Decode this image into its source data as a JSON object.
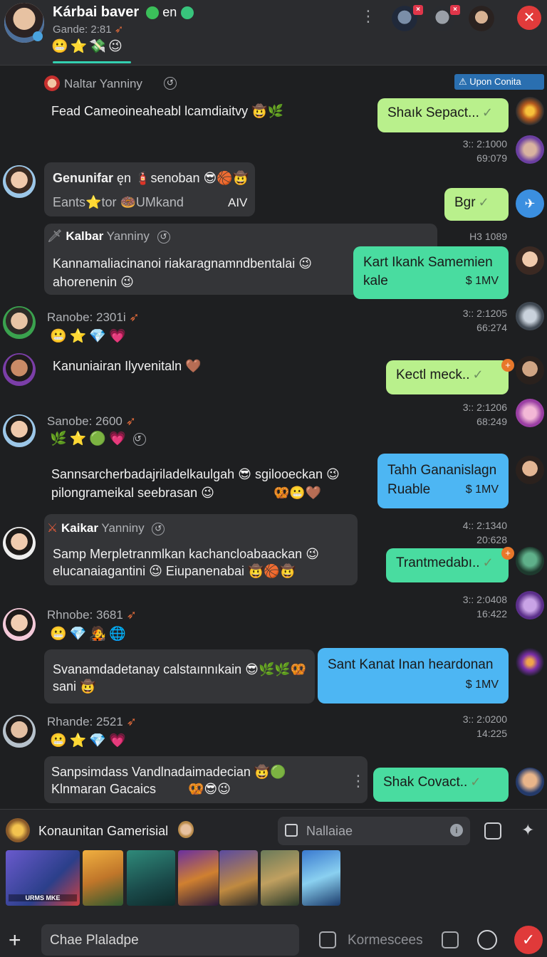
{
  "header": {
    "title": "Kárbai baver",
    "title_suffix": "en",
    "subtitle": "Gande: 2:81",
    "emojis": "😬⭐💸😉"
  },
  "upcoming_button": {
    "label": "Upon Conita"
  },
  "messages": {
    "m1": {
      "sender": "Naltar Yanniny",
      "text": "Fead Cameoineaheabl lcamdiaitvy 🤠🌿"
    },
    "o1": {
      "text": "Shaık Sepact...",
      "time1": "3:: 2:1000",
      "time2": "69:079"
    },
    "m2": {
      "title": "Genunifar",
      "title_rest": "ęn 🧯senoban 😎🏀🤠",
      "line2": "Eants⭐tor 🍩UMkand",
      "tag": "AIV"
    },
    "o2": {
      "text": "Bgr"
    },
    "m3": {
      "sender_bold": "Kalbar",
      "sender_rest": "Yanniny",
      "text1": "Kannamaliacinanoi riakaragnamndbentalai 😉",
      "text2": "ahorenenin 😉",
      "time": "H3 1089"
    },
    "o3": {
      "line1": "Kart Ikank Samemien",
      "line2": "kale",
      "meta": "$ 1MV"
    },
    "m4": {
      "sender": "Ranobe: 2301i",
      "emojis": "😬⭐💎💗"
    },
    "o4_time1": "3:: 2:1205",
    "o4_time2": "66:274",
    "m5": {
      "text": "Kanuniairan Ilyvenitaln 🤎"
    },
    "o5": {
      "text": "Kectl meck.."
    },
    "o5_time1": "3:: 2:1206",
    "o5_time2": "68:249",
    "m6": {
      "sender": "Sanobe: 2600",
      "emojis": "🌿⭐🟢💗",
      "text1": "Sannsarcherbadajriladelkaulgah 😎 sgilooeckan 😉",
      "text2": "pilongrameikal seebrasan 😉",
      "trail": "🥨😬🤎"
    },
    "o6": {
      "line1": "Tahh Gananislagn",
      "line2": "Ruable",
      "meta": "$ 1MV"
    },
    "m7": {
      "sender_bold": "Kaikar",
      "sender_rest": "Yanniny",
      "text1": "Samp Merpletranmlkan kachancloabaackan 😉",
      "text2": "elucanaiagantini 😉 Eiupanenabai 🤠🏀🤠"
    },
    "o7_time1": "4:: 2:1340",
    "o7_time2": "20:628",
    "o7": {
      "text": "Trantmedabı.."
    },
    "m8": {
      "sender": "Rhnobe: 3681",
      "emojis": "😬💎🧑‍🎤🌐",
      "text1": "Svanamdadetanay calstaınnıkain 😎🌿🌿🥨",
      "text2": "sani 🤠"
    },
    "o8_time1": "3:: 2:0408",
    "o8_time2": "16:422",
    "o8": {
      "line1": "Sant Kanat Inan heardonan",
      "meta": "$ 1MV"
    },
    "m9": {
      "sender": "Rhande: 2521",
      "emojis": "😬⭐💎💗",
      "text1": "Sanpsimdass Vandlnadaimadecian 🤠🟢",
      "text2": "Klnmaran Gacaics",
      "trail": "🥨😎😉"
    },
    "o9_time1": "3:: 2:0200",
    "o9_time2": "14:225",
    "o9": {
      "text": "Shak Covact.."
    }
  },
  "composer": {
    "channel_label": "Konaunitan Gamerisial",
    "search_placeholder": "Nallaiae",
    "input_placeholder": "Chae Plaladpe",
    "secondary_label": "Kormescees"
  },
  "thumbnails": [
    "URMS MKE",
    "",
    "",
    "",
    "",
    "",
    ""
  ]
}
